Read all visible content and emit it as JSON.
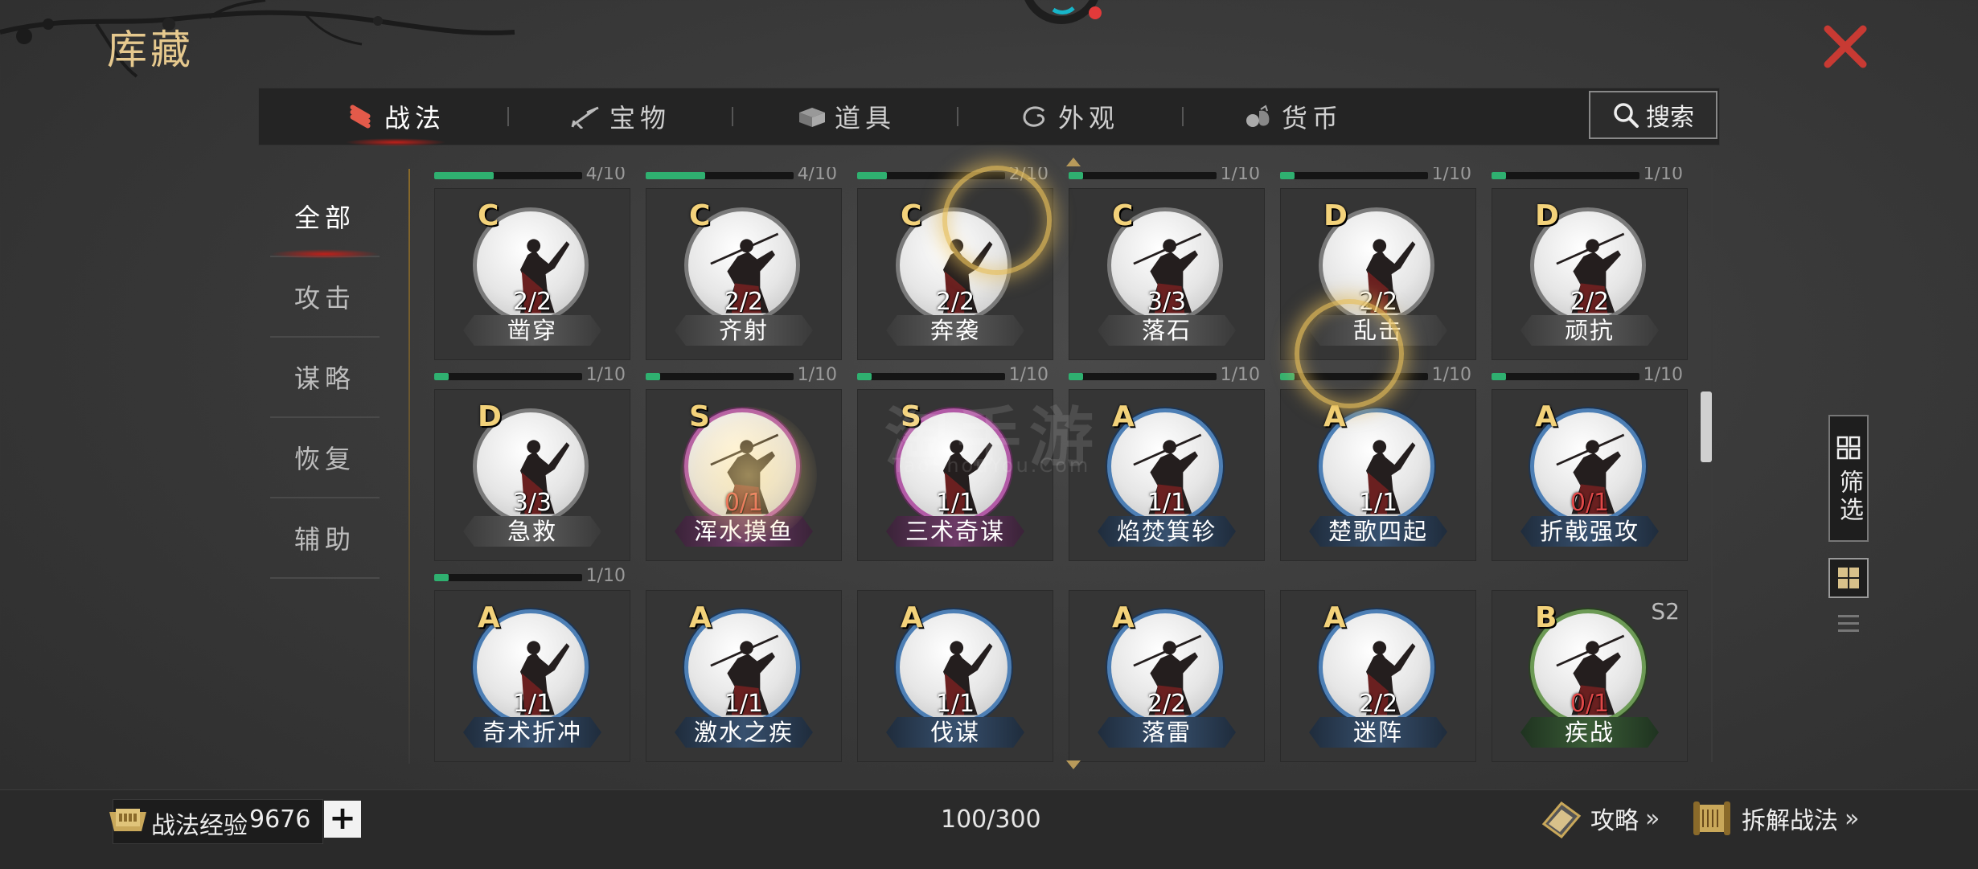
{
  "title": "库藏",
  "tabs": [
    {
      "label": "战法",
      "icon": "scroll-bundle-icon",
      "active": true
    },
    {
      "label": "宝物",
      "icon": "weapon-icon",
      "active": false
    },
    {
      "label": "道具",
      "icon": "box-icon",
      "active": false
    },
    {
      "label": "外观",
      "icon": "swirl-icon",
      "active": false
    },
    {
      "label": "货币",
      "icon": "coin-bag-icon",
      "active": false
    }
  ],
  "search": {
    "label": "搜索",
    "icon": "search-icon"
  },
  "categories": [
    {
      "label": "全部",
      "active": true
    },
    {
      "label": "攻击",
      "active": false
    },
    {
      "label": "谋略",
      "active": false
    },
    {
      "label": "恢复",
      "active": false
    },
    {
      "label": "辅助",
      "active": false
    }
  ],
  "cards": [
    {
      "name": "凿穿",
      "grade": "C",
      "qty": "2/2",
      "progress": "4/10",
      "progress_fraction": 0.4
    },
    {
      "name": "齐射",
      "grade": "C",
      "qty": "2/2",
      "progress": "4/10",
      "progress_fraction": 0.4
    },
    {
      "name": "奔袭",
      "grade": "C",
      "qty": "2/2",
      "progress": "2/10",
      "progress_fraction": 0.2
    },
    {
      "name": "落石",
      "grade": "C",
      "qty": "3/3",
      "progress": "1/10",
      "progress_fraction": 0.1
    },
    {
      "name": "乱击",
      "grade": "D",
      "qty": "2/2",
      "progress": "1/10",
      "progress_fraction": 0.1
    },
    {
      "name": "顽抗",
      "grade": "D",
      "qty": "2/2",
      "progress": "1/10",
      "progress_fraction": 0.1
    },
    {
      "name": "急救",
      "grade": "D",
      "qty": "3/3",
      "progress": "1/10",
      "progress_fraction": 0.1
    },
    {
      "name": "浑水摸鱼",
      "grade": "S",
      "qty": "0/1",
      "progress": "1/10",
      "progress_fraction": 0.1
    },
    {
      "name": "三术奇谋",
      "grade": "S",
      "qty": "1/1",
      "progress": "1/10",
      "progress_fraction": 0.1
    },
    {
      "name": "焰焚箕轸",
      "grade": "A",
      "qty": "1/1",
      "progress": "1/10",
      "progress_fraction": 0.1
    },
    {
      "name": "楚歌四起",
      "grade": "A",
      "qty": "1/1",
      "progress": "1/10",
      "progress_fraction": 0.1
    },
    {
      "name": "折戟强攻",
      "grade": "A",
      "qty": "0/1",
      "progress": "1/10",
      "progress_fraction": 0.1
    },
    {
      "name": "奇术折冲",
      "grade": "A",
      "qty": "1/1",
      "progress": "1/10",
      "progress_fraction": 0.1
    },
    {
      "name": "激水之疾",
      "grade": "A",
      "qty": "1/1",
      "progress": "",
      "progress_fraction": null
    },
    {
      "name": "伐谋",
      "grade": "A",
      "qty": "1/1",
      "progress": "",
      "progress_fraction": null
    },
    {
      "name": "落雷",
      "grade": "A",
      "qty": "2/2",
      "progress": "",
      "progress_fraction": null
    },
    {
      "name": "迷阵",
      "grade": "A",
      "qty": "2/2",
      "progress": "",
      "progress_fraction": null
    },
    {
      "name": "疾战",
      "grade": "B",
      "qty": "0/1",
      "progress": "",
      "progress_fraction": null,
      "season": "S2"
    }
  ],
  "filter": {
    "label": "筛选",
    "icon": "filter-grid-icon"
  },
  "watermark": {
    "main": "淘手游",
    "sub": "TaoShouYou.Com"
  },
  "bottom": {
    "exp_label": "战法经验",
    "exp_value": "9676",
    "plus": "+",
    "capacity": "100/300",
    "strategy_link": "攻略",
    "disassemble_link": "拆解战法",
    "chevron": "»"
  },
  "colors": {
    "accent_gold": "#e6c98e",
    "progress_green": "#2fb070",
    "active_red": "#c0201a",
    "zero_qty_red": "#e04848"
  }
}
